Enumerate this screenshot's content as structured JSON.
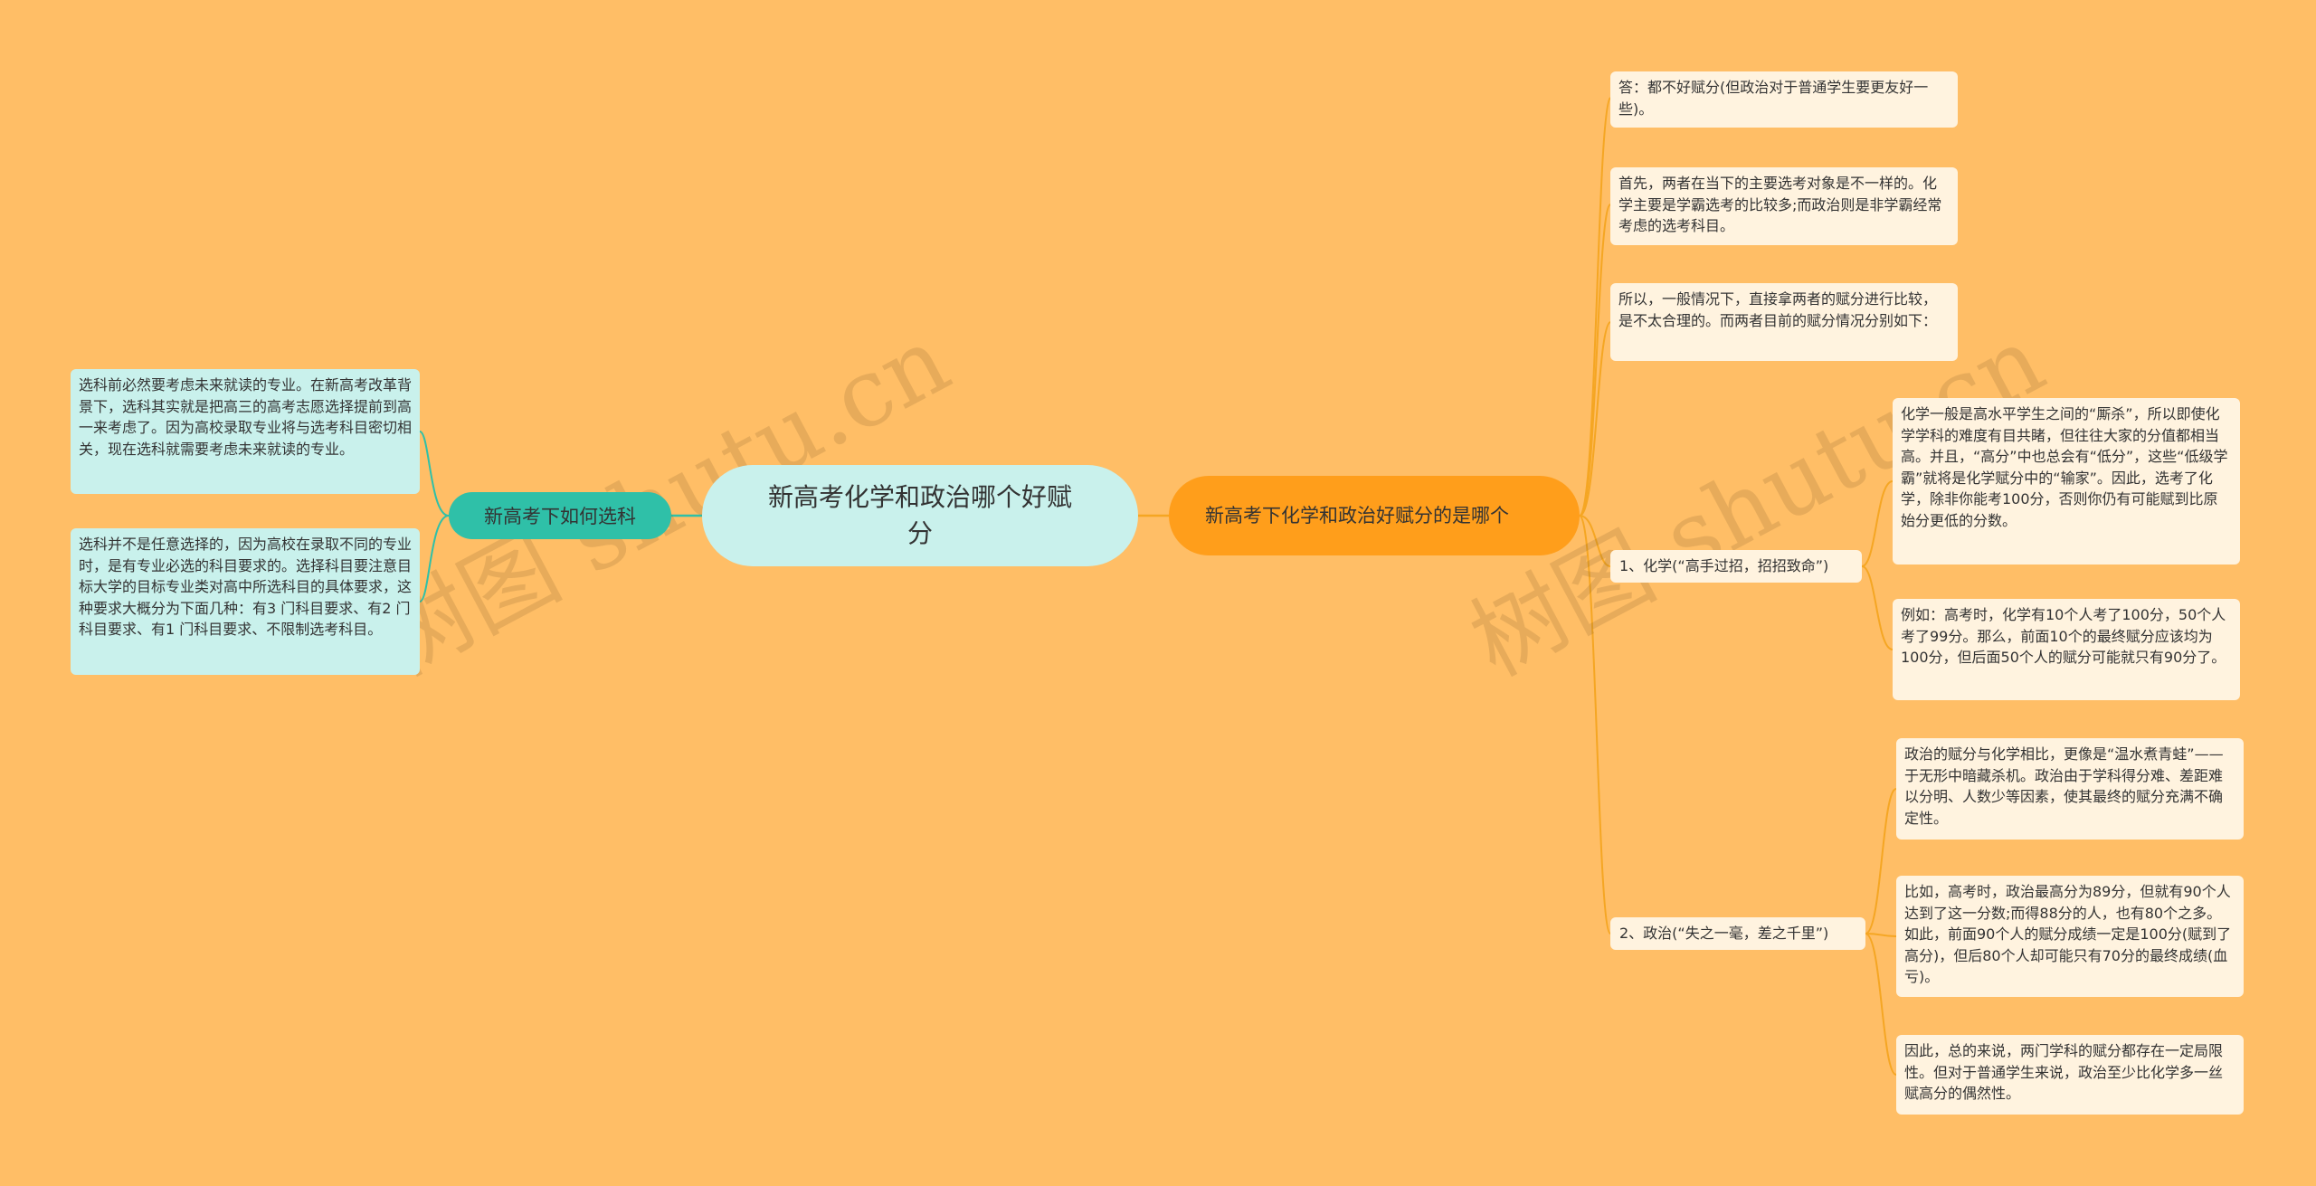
{
  "root": {
    "title": "新高考化学和政治哪个好赋分"
  },
  "left_branch": {
    "label": "新高考下如何选科",
    "items": [
      "选科前必然要考虑未来就读的专业。在新高考改革背景下，选科其实就是把高三的高考志愿选择提前到高一来考虑了。因为高校录取专业将与选考科目密切相关，现在选科就需要考虑未来就读的专业。",
      "选科并不是任意选择的，因为高校在录取不同的专业时，是有专业必选的科目要求的。选择科目要注意目标大学的目标专业类对高中所选科目的具体要求，这种要求大概分为下面几种：有3 门科目要求、有2 门科目要求、有1 门科目要求、不限制选考科目。"
    ]
  },
  "right_branch": {
    "label": "新高考下化学和政治好赋分的是哪个",
    "items": [
      "答：都不好赋分(但政治对于普通学生要更友好一些)。",
      "首先，两者在当下的主要选考对象是不一样的。化学主要是学霸选考的比较多;而政治则是非学霸经常考虑的选考科目。",
      "所以，一般情况下，直接拿两者的赋分进行比较，是不太合理的。而两者目前的赋分情况分别如下："
    ],
    "chemistry": {
      "label": "1、化学(“高手过招，招招致命”)",
      "items": [
        "化学一般是高水平学生之间的“厮杀”，所以即使化学学科的难度有目共睹，但往往大家的分值都相当高。并且，“高分”中也总会有“低分”，这些“低级学霸”就将是化学赋分中的“输家”。因此，选考了化学，除非你能考100分，否则你仍有可能赋到比原始分更低的分数。",
        "例如：高考时，化学有10个人考了100分，50个人考了99分。那么，前面10个的最终赋分应该均为100分，但后面50个人的赋分可能就只有90分了。"
      ]
    },
    "politics": {
      "label": "2、政治(“失之一毫，差之千里”)",
      "items": [
        "政治的赋分与化学相比，更像是“温水煮青蛙”——于无形中暗藏杀机。政治由于学科得分难、差距难以分明、人数少等因素，使其最终的赋分充满不确定性。",
        "比如，高考时，政治最高分为89分，但就有90个人达到了这一分数;而得88分的人，也有80个之多。如此，前面90个人的赋分成绩一定是100分(赋到了高分)，但后80个人却可能只有70分的最终成绩(血亏)。",
        "因此，总的来说，两门学科的赋分都存在一定局限性。但对于普通学生来说，政治至少比化学多一丝赋高分的偶然性。"
      ]
    }
  },
  "watermarks": [
    "树图 shutu.cn",
    "树图 shutu.cn"
  ],
  "colors": {
    "background": "#ffbe66",
    "root": "#c9f1ec",
    "left_branch": "#2fc0a8",
    "right_branch": "#ff9e1b",
    "card": "#fff3df",
    "left_link": "#2fc0a8",
    "right_link": "#f5a623"
  }
}
